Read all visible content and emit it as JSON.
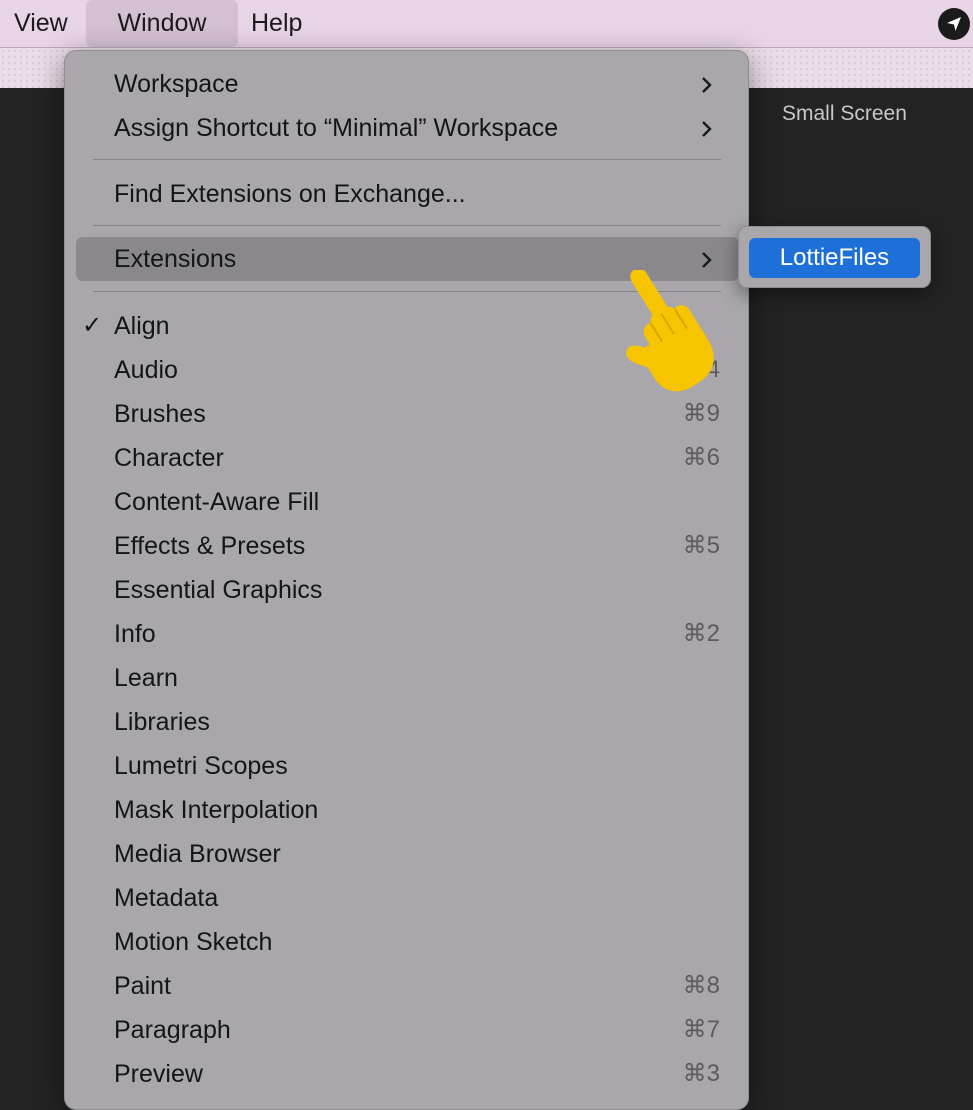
{
  "menubar": {
    "items": [
      "View",
      "Window",
      "Help"
    ]
  },
  "workspace": {
    "label": "Small Screen"
  },
  "menu": {
    "top_items": [
      {
        "label": "Workspace",
        "has_submenu": true
      },
      {
        "label": "Assign Shortcut to “Minimal” Workspace",
        "has_submenu": true
      }
    ],
    "find_extensions": "Find Extensions on Exchange...",
    "extensions": {
      "label": "Extensions",
      "has_submenu": true
    },
    "panels": [
      {
        "label": "Align",
        "shortcut": "",
        "checked": true
      },
      {
        "label": "Audio",
        "shortcut": "⌘4"
      },
      {
        "label": "Brushes",
        "shortcut": "⌘9"
      },
      {
        "label": "Character",
        "shortcut": "⌘6"
      },
      {
        "label": "Content-Aware Fill",
        "shortcut": ""
      },
      {
        "label": "Effects & Presets",
        "shortcut": "⌘5"
      },
      {
        "label": "Essential Graphics",
        "shortcut": ""
      },
      {
        "label": "Info",
        "shortcut": "⌘2"
      },
      {
        "label": "Learn",
        "shortcut": ""
      },
      {
        "label": "Libraries",
        "shortcut": ""
      },
      {
        "label": "Lumetri Scopes",
        "shortcut": ""
      },
      {
        "label": "Mask Interpolation",
        "shortcut": ""
      },
      {
        "label": "Media Browser",
        "shortcut": ""
      },
      {
        "label": "Metadata",
        "shortcut": ""
      },
      {
        "label": "Motion Sketch",
        "shortcut": ""
      },
      {
        "label": "Paint",
        "shortcut": "⌘8"
      },
      {
        "label": "Paragraph",
        "shortcut": "⌘7"
      },
      {
        "label": "Preview",
        "shortcut": "⌘3"
      }
    ],
    "checkmark": "✓"
  },
  "submenu": {
    "items": [
      "LottieFiles"
    ]
  },
  "colors": {
    "menubar_bg": "#e7d4e5",
    "menu_bg": "#a9a6ac",
    "highlight_bg": "#8a878d",
    "submenu_selected": "#1f6fd9",
    "hand": "#f6c400",
    "app_bg": "#232323"
  },
  "icons": {
    "menubar_right": "location-arrow-icon",
    "submenu_indicator": "chevron-right-icon",
    "pointer": "pointing-hand-icon"
  }
}
